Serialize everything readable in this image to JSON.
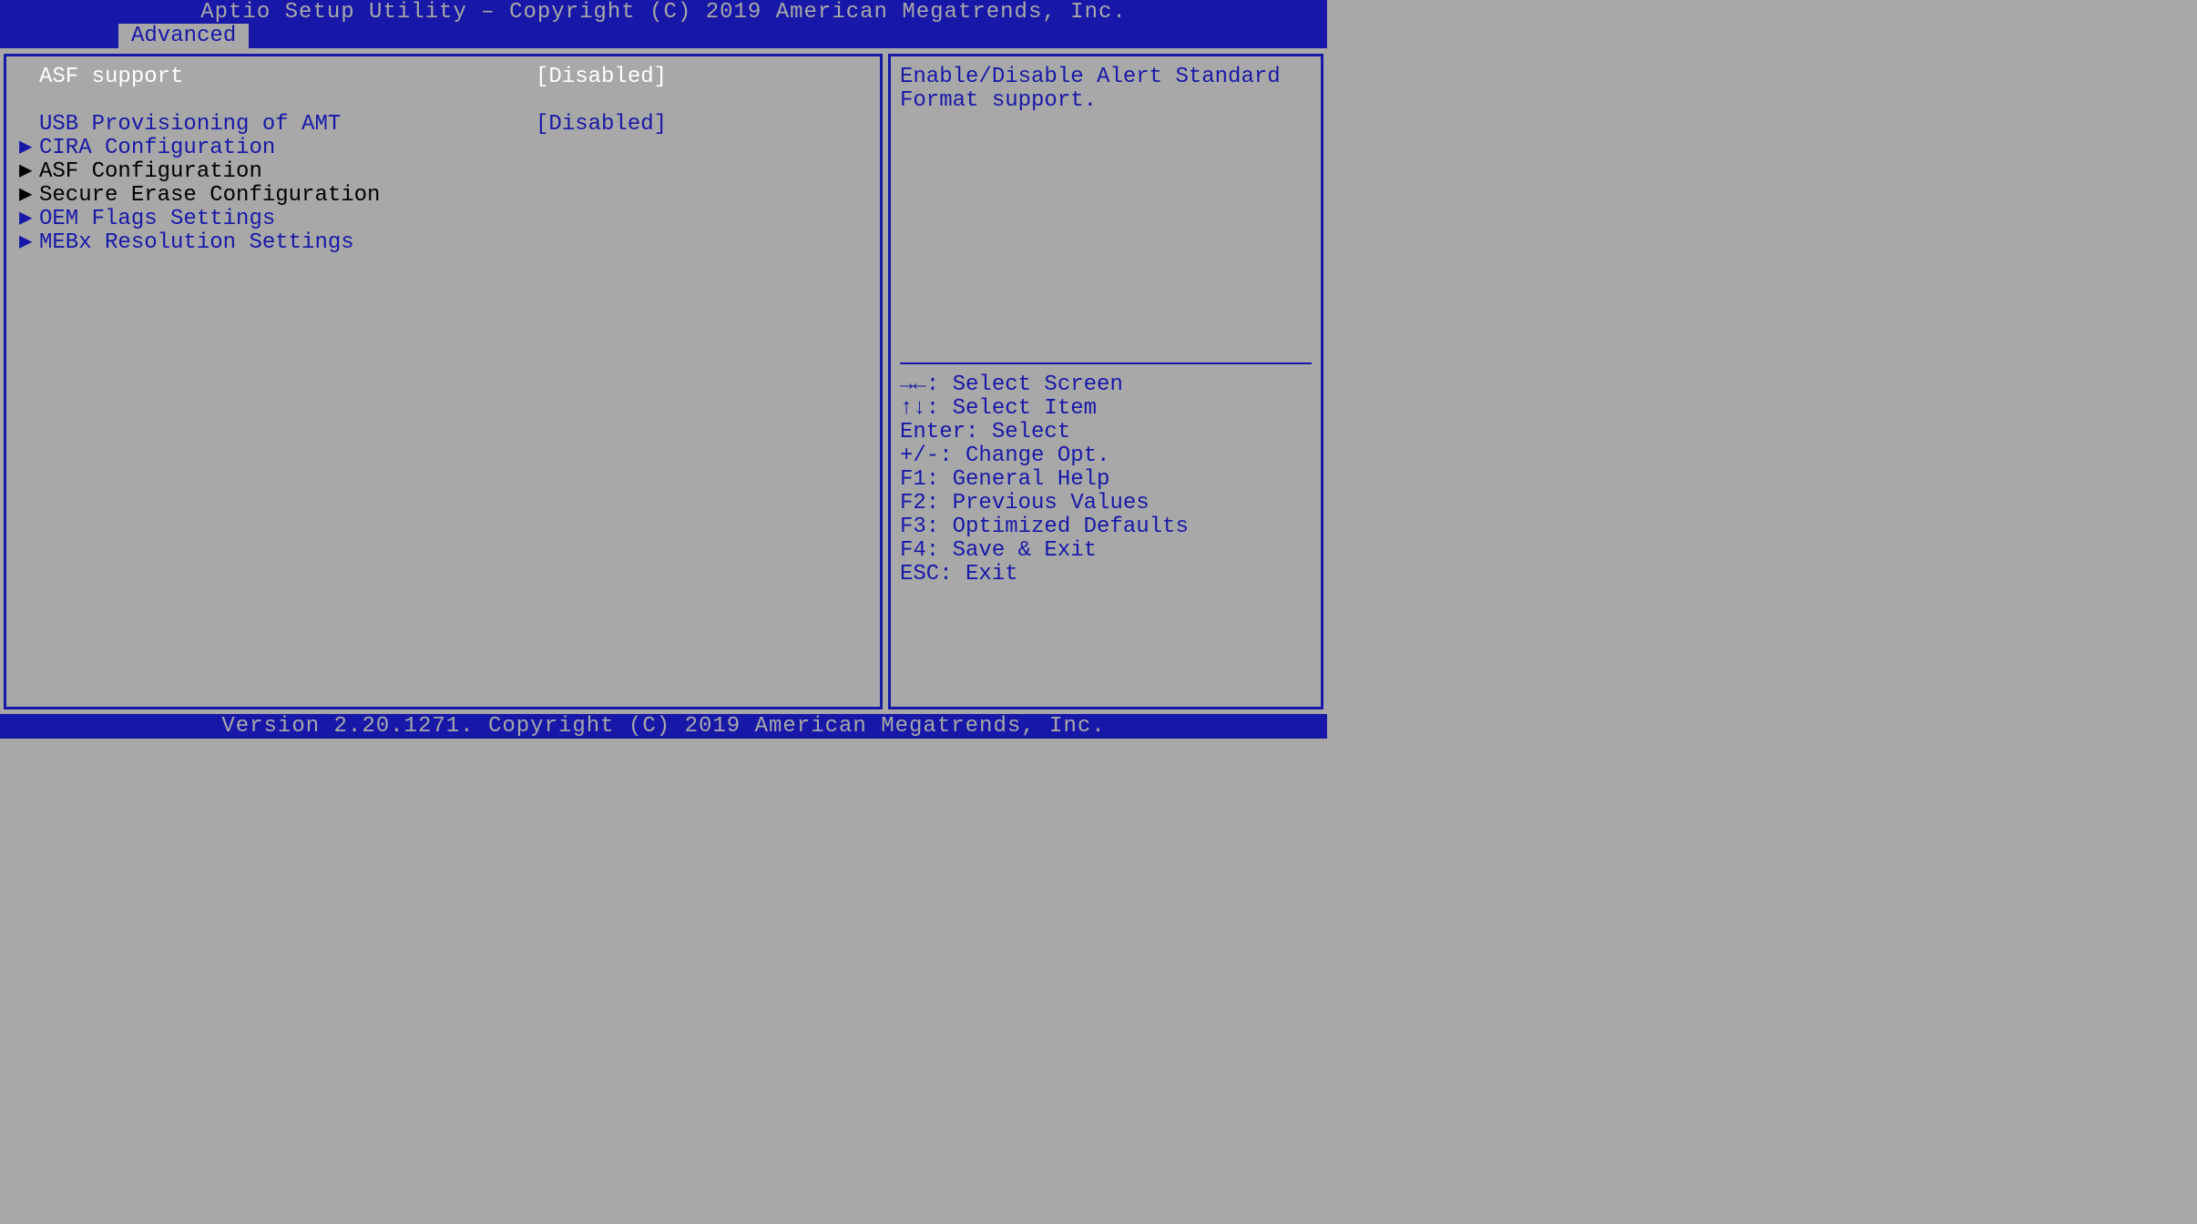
{
  "header": {
    "title": "Aptio Setup Utility – Copyright (C) 2019 American Megatrends, Inc."
  },
  "tabs": {
    "active": "Advanced"
  },
  "menu": {
    "items": [
      {
        "label": "ASF support",
        "value": "[Disabled]",
        "marker": "",
        "style": "selected"
      },
      {
        "label": "",
        "value": "",
        "marker": "",
        "style": "blank"
      },
      {
        "label": "USB Provisioning of AMT",
        "value": "[Disabled]",
        "marker": "",
        "style": "normal"
      },
      {
        "label": "CIRA Configuration",
        "value": "",
        "marker": "▶",
        "style": "normal"
      },
      {
        "label": "ASF Configuration",
        "value": "",
        "marker": "▶",
        "style": "black"
      },
      {
        "label": "Secure Erase Configuration",
        "value": "",
        "marker": "▶",
        "style": "black"
      },
      {
        "label": "OEM Flags Settings",
        "value": "",
        "marker": "▶",
        "style": "normal"
      },
      {
        "label": "MEBx Resolution Settings",
        "value": "",
        "marker": "▶",
        "style": "normal"
      }
    ]
  },
  "help": {
    "text": "Enable/Disable Alert Standard Format support."
  },
  "hotkeys": [
    "→←: Select Screen",
    "↑↓: Select Item",
    "Enter: Select",
    "+/-: Change Opt.",
    "F1: General Help",
    "F2: Previous Values",
    "F3: Optimized Defaults",
    "F4: Save & Exit",
    "ESC: Exit"
  ],
  "footer": {
    "text": "Version 2.20.1271. Copyright (C) 2019 American Megatrends, Inc."
  }
}
